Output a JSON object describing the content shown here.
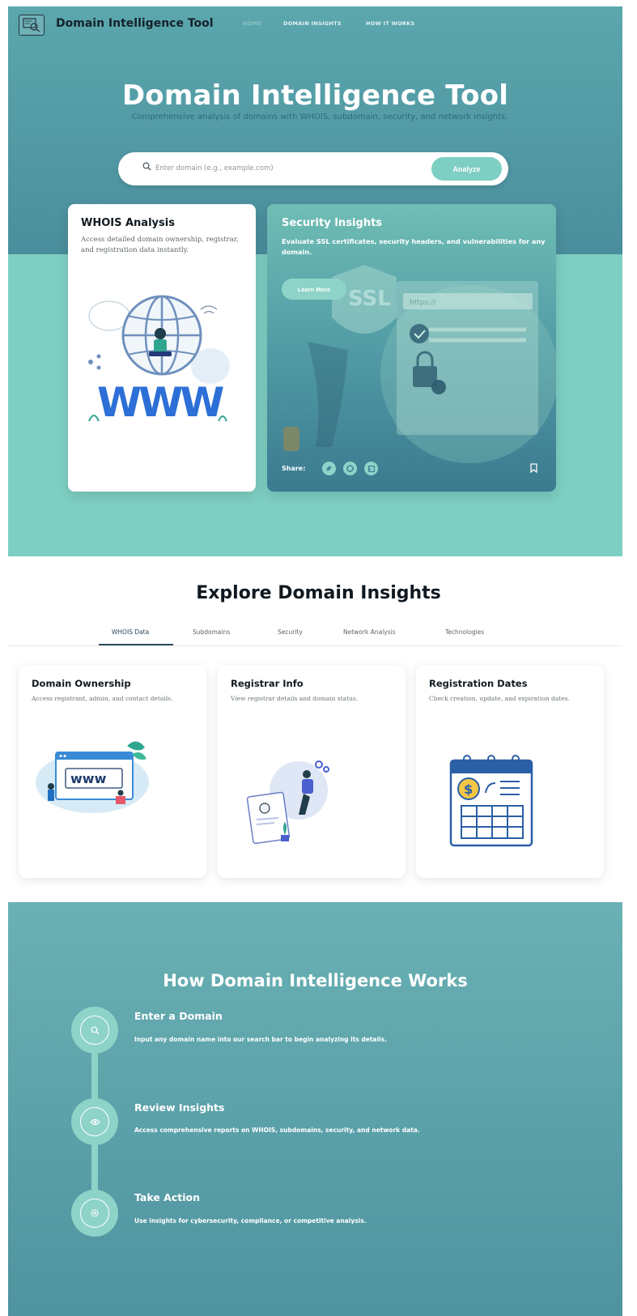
{
  "nav": {
    "logo_icon": "domain-search-icon",
    "title": "Domain Intelligence Tool",
    "links": [
      "HOME",
      "DOMAIN INSIGHTS",
      "HOW IT WORKS"
    ]
  },
  "hero": {
    "title": "Domain Intelligence Tool",
    "subtitle": "Comprehensive analysis of domains with WHOIS, subdomain, security, and network insights.",
    "search_placeholder": "Enter domain (e.g., example.com)",
    "search_button": "Analyze"
  },
  "whois_card": {
    "title": "WHOIS Analysis",
    "description": "Access detailed domain ownership, registrar, and registration data instantly."
  },
  "security_card": {
    "title": "Security Insights",
    "description": "Evaluate SSL certificates, security headers, and vulnerabilities for any domain.",
    "button": "Learn More",
    "share_label": "Share:",
    "share_icons": [
      "twitter-icon",
      "pinterest-icon",
      "linkedin-icon"
    ],
    "art_text_ssl": "SSL",
    "art_text_https": "https://"
  },
  "explore": {
    "title": "Explore Domain Insights",
    "tabs": [
      "WHOIS Data",
      "Subdomains",
      "Security",
      "Network Analysis",
      "Technologies"
    ],
    "active_tab": "WHOIS Data",
    "cards": [
      {
        "title": "Domain Ownership",
        "description": "Access registrant, admin, and contact details.",
        "art_text": "www"
      },
      {
        "title": "Registrar Info",
        "description": "View registrar details and domain status."
      },
      {
        "title": "Registration Dates",
        "description": "Check creation, update, and expiration dates."
      }
    ]
  },
  "how": {
    "title": "How Domain Intelligence Works",
    "steps": [
      {
        "title": "Enter a Domain",
        "description": "Input any domain name into our search bar to begin analyzing its details.",
        "icon": "search-icon"
      },
      {
        "title": "Review Insights",
        "description": "Access comprehensive reports on WHOIS, subdomains, security, and network data.",
        "icon": "eye-icon"
      },
      {
        "title": "Take Action",
        "description": "Use insights for cybersecurity, compliance, or competitive analysis.",
        "icon": "gear-icon"
      }
    ]
  },
  "colors": {
    "teal_light": "#7ecfc3",
    "teal_dark": "#4a8e9d",
    "navy_text": "#14222a"
  }
}
